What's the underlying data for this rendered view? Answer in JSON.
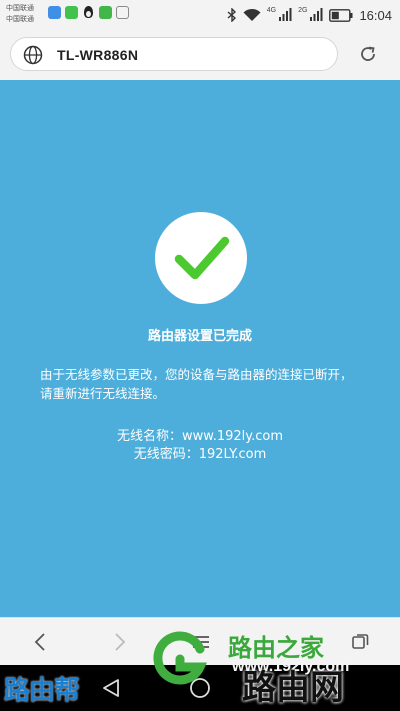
{
  "status_bar": {
    "carrier_line1": "中国联通",
    "carrier_line2": "中国联通",
    "network_4g": "4G",
    "network_2g": "2G",
    "time": "16:04",
    "notification_icons": [
      "alipay-icon",
      "wechat-icon",
      "qq-icon",
      "app-icon",
      "image-icon"
    ]
  },
  "address_bar": {
    "url": "TL-WR886N"
  },
  "page": {
    "title": "路由器设置已完成",
    "message": "由于无线参数已更改，您的设备与路由器的连接已断开，请重新进行无线连接。",
    "ssid_label": "无线名称：",
    "ssid_value": "www.192ly.com",
    "password_label": "无线密码：",
    "password_value": "192LY.com",
    "accent_color": "#4daedb",
    "check_color": "#4bc92e"
  },
  "watermarks": {
    "left": "路由帮",
    "main": "路由之家",
    "url": "www.192ly.com",
    "right": "路由网"
  }
}
